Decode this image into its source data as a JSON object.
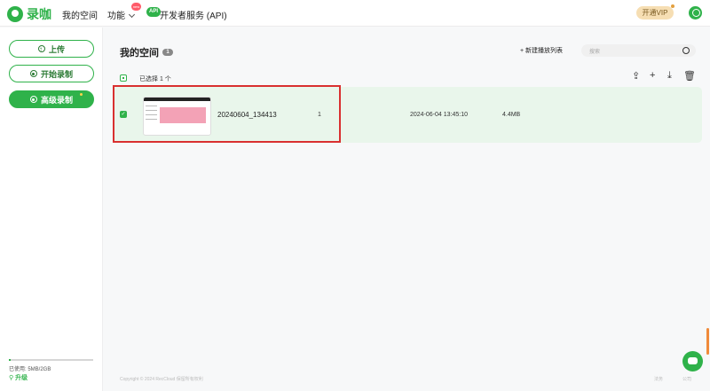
{
  "header": {
    "logo_text": "录咖",
    "nav": {
      "my_space": "我的空间",
      "features": "功能",
      "new_badge": "new",
      "api_tag": "API",
      "dev_service": "开发者服务 (API)"
    },
    "vip_label": "开通VIP"
  },
  "sidebar": {
    "upload": "上传",
    "start_record": "开始录制",
    "advanced_record": "高级录制",
    "usage_label": "已使用: 5MB/2GB",
    "usage_fraction": 0.0025,
    "upgrade_label": "升级"
  },
  "main": {
    "title": "我的空间",
    "count_badge": "1",
    "new_playlist": "新建播放列表",
    "search_placeholder": "搜索",
    "selected_text": "已选择 1 个",
    "toolbar": {
      "share": "⇪",
      "add": "+",
      "download": "⤓",
      "delete": "🗑"
    },
    "rows": [
      {
        "name": "20240604_134413",
        "count": "1",
        "date": "2024-06-04 13:45:10",
        "size": "4.4MB",
        "checked": true
      }
    ]
  },
  "footer": {
    "copyright": "Copyright © 2024 RecCloud 保留所有权利",
    "link_1": "法务",
    "link_2": "公司"
  },
  "colors": {
    "brand": "#2fb24a",
    "row_selected": "#e9f6eb",
    "highlight": "#d93030"
  }
}
